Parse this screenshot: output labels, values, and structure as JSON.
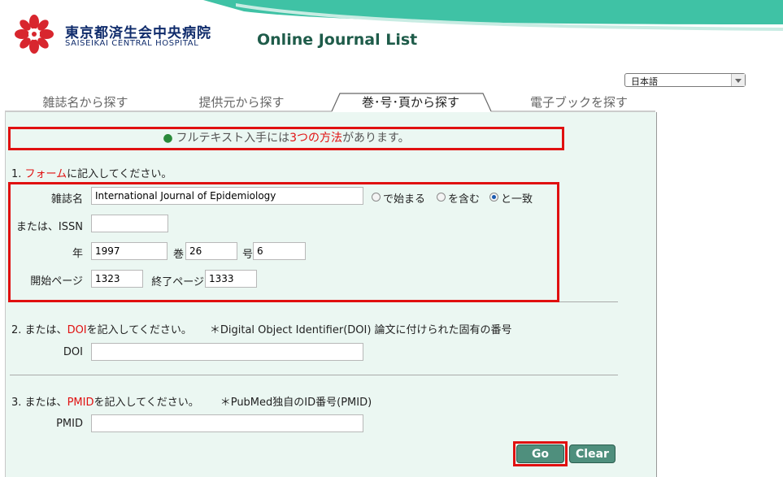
{
  "header": {
    "hospital_name_jp": "東京都済生会中央病院",
    "hospital_name_en": "SAISEIKAI CENTRAL HOSPITAL",
    "site_title": "Online Journal List",
    "logo_icon": "saiseikai-emblem-icon"
  },
  "language": {
    "selected": "日本語"
  },
  "tabs": [
    {
      "label": "雑誌名から探す",
      "active": false
    },
    {
      "label": "提供元から探す",
      "active": false
    },
    {
      "label": "巻･号･頁から探す",
      "active": true
    },
    {
      "label": "電子ブックを探す",
      "active": false
    }
  ],
  "notice": {
    "prefix": "フルテキスト入手には",
    "highlight": "3つの方法",
    "suffix": "があります。"
  },
  "section1": {
    "number": "1.",
    "highlight": "フォーム",
    "suffix": "に記入してください。",
    "journal_label": "雑誌名",
    "journal_value": "International Journal of Epidemiology",
    "match_options": [
      "で始まる",
      "を含む",
      "と一致"
    ],
    "match_selected": "と一致",
    "issn_label": "または、ISSN",
    "issn_value": "",
    "year_label": "年",
    "year_value": "1997",
    "volume_label": "巻",
    "volume_value": "26",
    "issue_label": "号",
    "issue_value": "6",
    "start_page_label": "開始ページ",
    "start_page_value": "1323",
    "end_page_label": "終了ページ",
    "end_page_value": "1333"
  },
  "section2": {
    "number": "2.",
    "prefix": "または、",
    "highlight": "DOI",
    "suffix": "を記入してください。",
    "note": "＊Digital Object Identifier(DOI)  論文に付けられた固有の番号",
    "doi_label": "DOI",
    "doi_value": ""
  },
  "section3": {
    "number": "3.",
    "prefix": "または、",
    "highlight": "PMID",
    "suffix": "を記入してください。",
    "note": "＊PubMed独自のID番号(PMID)",
    "pmid_label": "PMID",
    "pmid_value": ""
  },
  "buttons": {
    "go": "Go",
    "clear": "Clear"
  },
  "colors": {
    "accent_red": "#e01010",
    "panel_bg": "#ebf7f2",
    "button_green": "#4f8f7d",
    "header_teal": "#3fc2a5",
    "title_green": "#1f5c4a"
  }
}
